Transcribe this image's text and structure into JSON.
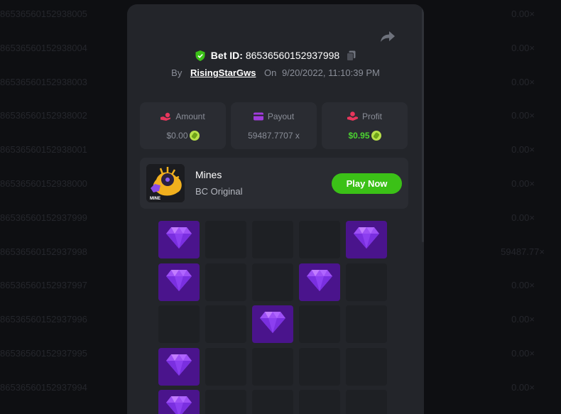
{
  "background_list": [
    {
      "id": "86536560152938005",
      "mult": "0.00×"
    },
    {
      "id": "86536560152938004",
      "mult": "0.00×"
    },
    {
      "id": "86536560152938003",
      "mult": "0.00×"
    },
    {
      "id": "86536560152938002",
      "mult": "0.00×"
    },
    {
      "id": "86536560152938001",
      "mult": "0.00×"
    },
    {
      "id": "86536560152938000",
      "mult": "0.00×"
    },
    {
      "id": "86536560152937999",
      "mult": "0.00×"
    },
    {
      "id": "86536560152937998",
      "mult": "59487.77×"
    },
    {
      "id": "86536560152937997",
      "mult": "0.00×"
    },
    {
      "id": "86536560152937996",
      "mult": "0.00×"
    },
    {
      "id": "86536560152937995",
      "mult": "0.00×"
    },
    {
      "id": "86536560152937994",
      "mult": "0.00×"
    }
  ],
  "bet": {
    "label": "Bet ID:",
    "id": "86536560152937998",
    "by_label": "By",
    "user": "RisingStarGws",
    "on_label": "On",
    "datetime": "9/20/2022, 11:10:39 PM"
  },
  "stats": {
    "amount": {
      "title": "Amount",
      "value": "$0.00"
    },
    "payout": {
      "title": "Payout",
      "value": "59487.7707 x"
    },
    "profit": {
      "title": "Profit",
      "value": "$0.95"
    }
  },
  "game": {
    "name": "Mines",
    "subtitle": "BC Original",
    "thumb_text": "MINE",
    "play_label": "Play Now"
  },
  "grid": {
    "rows": [
      [
        1,
        0,
        0,
        0,
        1
      ],
      [
        1,
        0,
        0,
        1,
        0
      ],
      [
        0,
        0,
        1,
        0,
        0
      ],
      [
        1,
        0,
        0,
        0,
        0
      ],
      [
        1,
        0,
        0,
        0,
        0
      ]
    ]
  },
  "colors": {
    "accent_green": "#3bc117",
    "profit_green": "#4cd431",
    "gem_tile": "#4a148c",
    "modal_bg": "#23252a"
  },
  "icons": {
    "share": "share-icon",
    "shield": "shield-check-icon",
    "copy": "copy-icon",
    "amount": "hand-coin-icon",
    "payout": "wallet-icon",
    "profit": "hand-heart-icon",
    "gem": "gem-icon",
    "coin": "coin-icon"
  }
}
